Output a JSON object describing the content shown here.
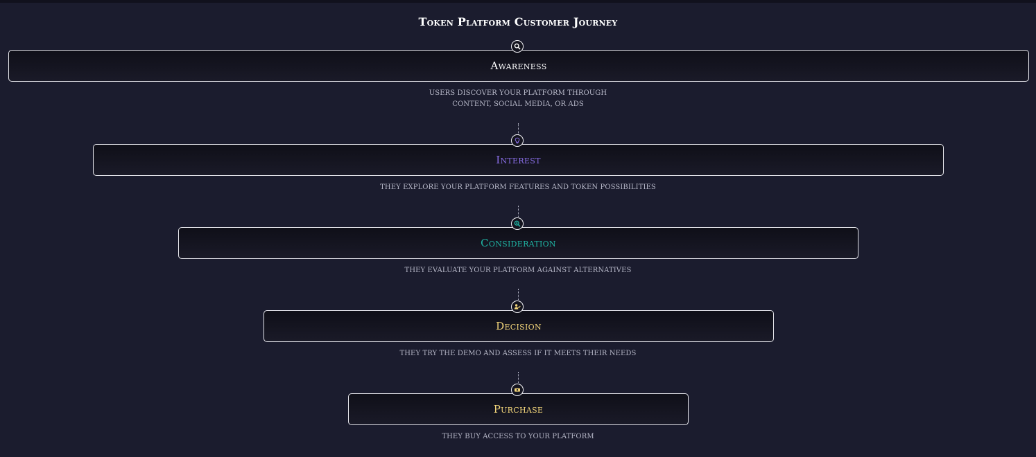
{
  "title": "Token Platform Customer Journey",
  "stages": [
    {
      "title": "Awareness",
      "description": "Users discover your platform through content, social media, or ads",
      "icon": "search-icon",
      "color": "#ffffff"
    },
    {
      "title": "Interest",
      "description": "They explore your platform features and token possibilities",
      "icon": "lightbulb-icon",
      "color": "#8a6fe8"
    },
    {
      "title": "Consideration",
      "description": "They evaluate your platform against alternatives",
      "icon": "zoom-in-icon",
      "color": "#1fb5a4"
    },
    {
      "title": "Decision",
      "description": "They try the demo and assess if it meets their needs",
      "icon": "user-check-icon",
      "color": "#f2d57a"
    },
    {
      "title": "Purchase",
      "description": "They buy access to your platform",
      "icon": "money-icon",
      "color": "#f2d57a"
    }
  ]
}
